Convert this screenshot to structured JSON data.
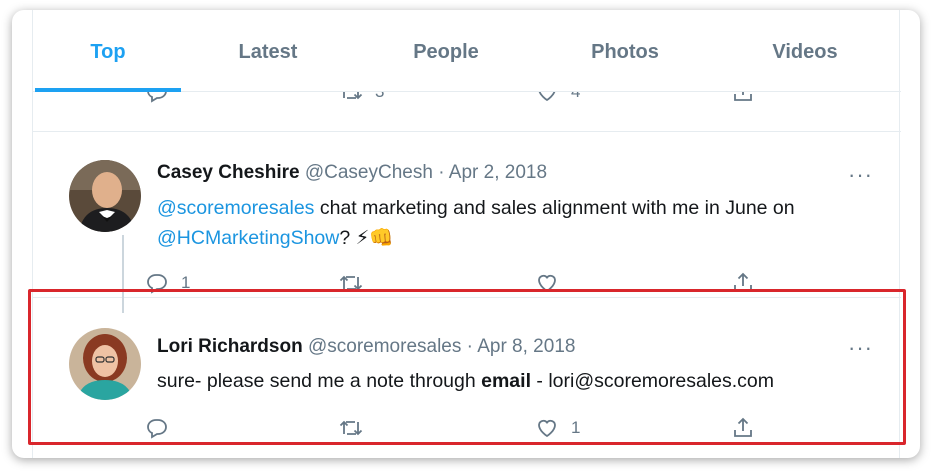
{
  "tabs": [
    {
      "label": "Top",
      "active": true
    },
    {
      "label": "Latest",
      "active": false
    },
    {
      "label": "People",
      "active": false
    },
    {
      "label": "Photos",
      "active": false
    },
    {
      "label": "Videos",
      "active": false
    }
  ],
  "previous_tweet": {
    "retweets": "3",
    "likes": "4"
  },
  "tweets": [
    {
      "name": "Casey Cheshire",
      "handle": "@CaseyChesh",
      "date": "· Apr 2, 2018",
      "text": {
        "mention1": "@scoremoresales",
        "part1": " chat marketing and sales alignment with me in June on ",
        "mention2": "@HCMarketingShow",
        "part2": "? ⚡👊"
      },
      "replies": "1",
      "retweets": "",
      "likes": ""
    },
    {
      "name": "Lori Richardson",
      "handle": "@scoremoresales",
      "date": "· Apr 8, 2018",
      "text": {
        "part1": "sure- please send me a note through ",
        "bold": "email",
        "part2": " - lori@scoremoresales.com"
      },
      "replies": "",
      "retweets": "",
      "likes": "1"
    }
  ],
  "more_label": "···",
  "colors": {
    "accent": "#1da1f2",
    "link": "#1b95e0",
    "muted": "#657786",
    "highlight": "#d9262c"
  },
  "icons": [
    "reply-icon",
    "retweet-icon",
    "like-icon",
    "share-icon",
    "more-icon"
  ]
}
